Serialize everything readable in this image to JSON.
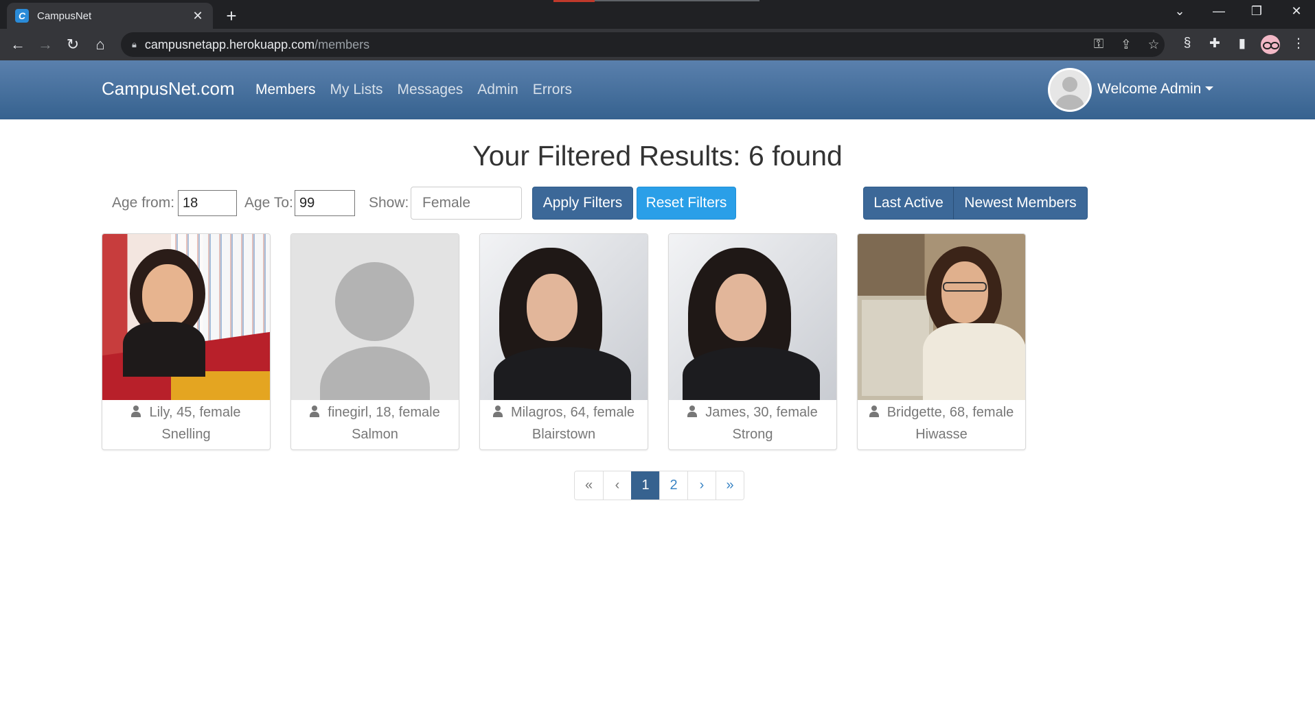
{
  "browser": {
    "tab_title": "CampusNet",
    "tab_favicon": "C",
    "url_host": "campusnetapp.herokuapp.com",
    "url_path": "/members"
  },
  "navbar": {
    "brand": "CampusNet.com",
    "links": [
      "Members",
      "My Lists",
      "Messages",
      "Admin",
      "Errors"
    ],
    "welcome": "Welcome Admin"
  },
  "main": {
    "title": "Your Filtered Results: 6 found",
    "filters": {
      "age_from_label": "Age from:",
      "age_from_value": "18",
      "age_to_label": "Age To:",
      "age_to_value": "99",
      "show_label": "Show:",
      "show_value": "Female",
      "apply_label": "Apply Filters",
      "reset_label": "Reset Filters"
    },
    "sort": {
      "last_active_label": "Last Active",
      "newest_label": "Newest Members"
    },
    "members": [
      {
        "line1": "Lily, 45, female",
        "city": "Snelling"
      },
      {
        "line1": "finegirl, 18, female",
        "city": "Salmon"
      },
      {
        "line1": "Milagros, 64, female",
        "city": "Blairstown"
      },
      {
        "line1": "James, 30, female",
        "city": "Strong"
      },
      {
        "line1": "Bridgette, 68, female",
        "city": "Hiwasse"
      }
    ],
    "pagination": {
      "first": "«",
      "prev": "‹",
      "pages": [
        "1",
        "2"
      ],
      "current": "1",
      "next": "›",
      "last": "»"
    }
  },
  "colors": {
    "navbar": "#36628f",
    "primary_button": "#3c6898",
    "info_button": "#2a9fe8",
    "link": "#3a84c4"
  }
}
